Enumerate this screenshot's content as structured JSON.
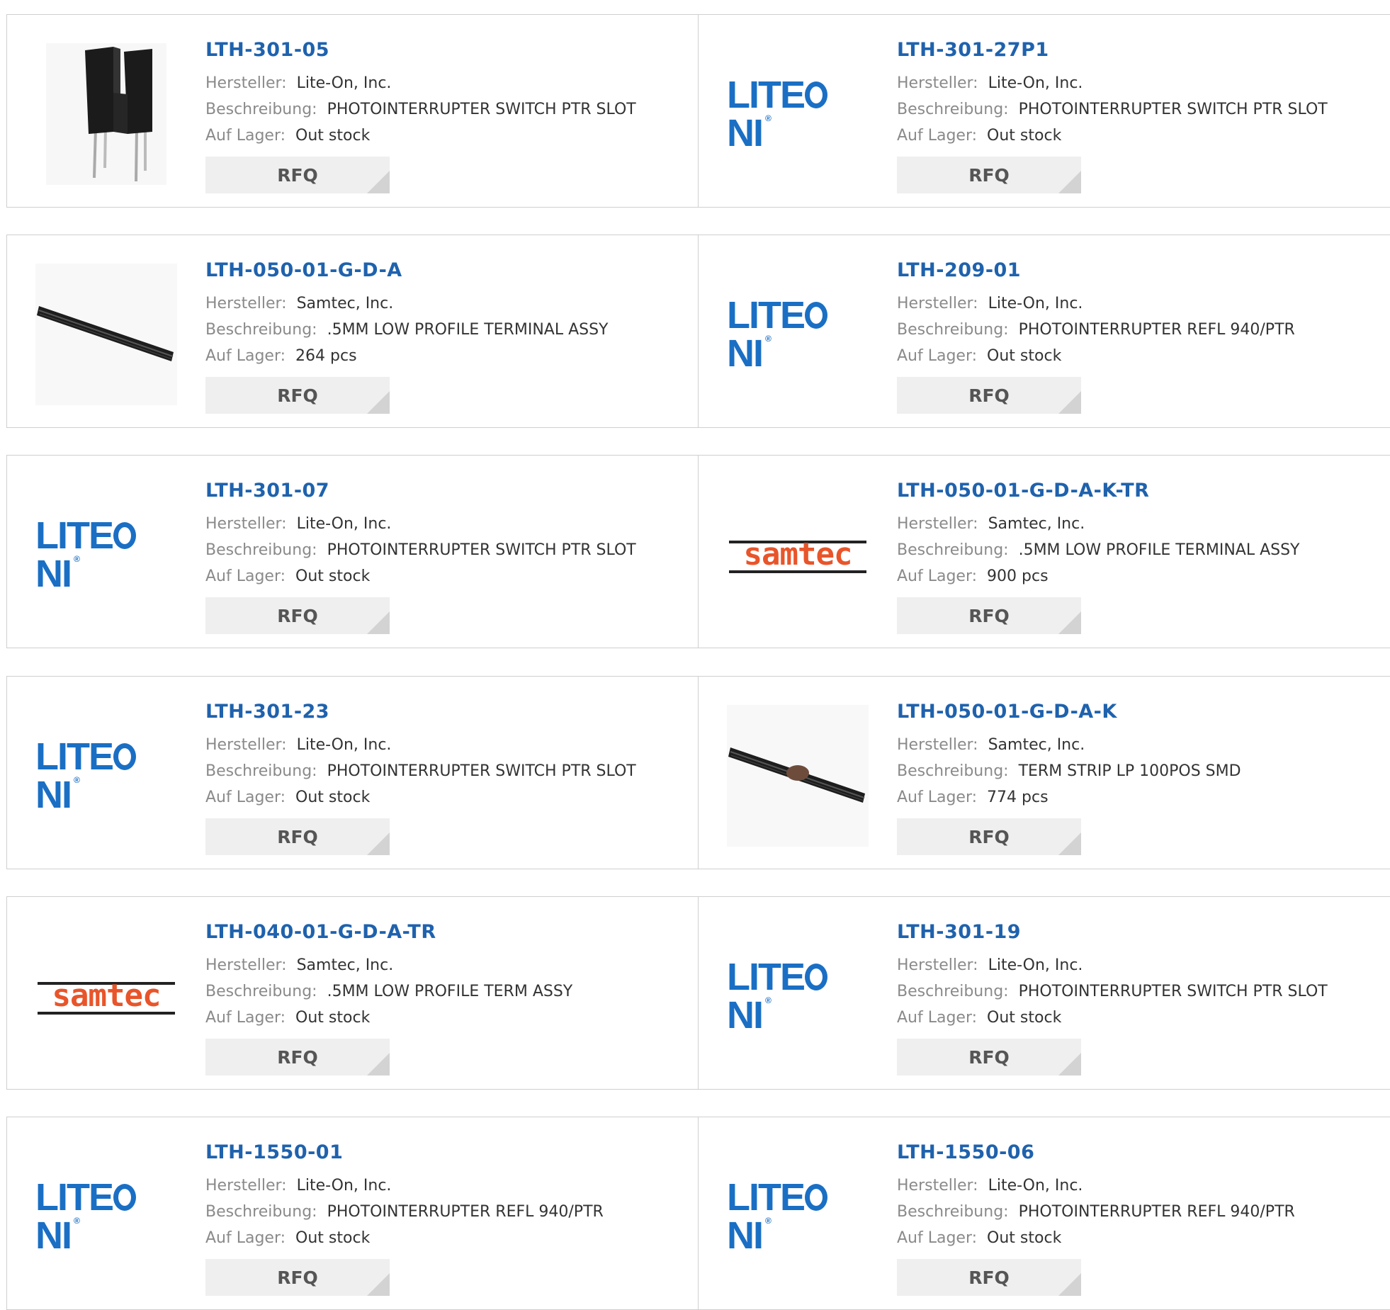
{
  "labels": {
    "manufacturer": "Hersteller:",
    "description": "Beschreibung:",
    "stock": "Auf Lager:",
    "rfq": "RFQ"
  },
  "logos": {
    "liteon": "LITEON",
    "samtec": "samtec"
  },
  "products": [
    {
      "pn": "LTH-301-05",
      "manufacturer": "Lite-On, Inc.",
      "description": "PHOTOINTERRUPTER SWITCH PTR SLOT",
      "stock": "Out stock",
      "image": "photointerrupter-photo"
    },
    {
      "pn": "LTH-301-27P1",
      "manufacturer": "Lite-On, Inc.",
      "description": "PHOTOINTERRUPTER SWITCH PTR SLOT",
      "stock": "Out stock",
      "image": "liteon-logo"
    },
    {
      "pn": "LTH-050-01-G-D-A",
      "manufacturer": "Samtec, Inc.",
      "description": ".5MM LOW PROFILE TERMINAL ASSY",
      "stock": "264 pcs",
      "image": "terminal-strip-photo"
    },
    {
      "pn": "LTH-209-01",
      "manufacturer": "Lite-On, Inc.",
      "description": "PHOTOINTERRUPTER REFL 940/PTR",
      "stock": "Out stock",
      "image": "liteon-logo"
    },
    {
      "pn": "LTH-301-07",
      "manufacturer": "Lite-On, Inc.",
      "description": "PHOTOINTERRUPTER SWITCH PTR SLOT",
      "stock": "Out stock",
      "image": "liteon-logo"
    },
    {
      "pn": "LTH-050-01-G-D-A-K-TR",
      "manufacturer": "Samtec, Inc.",
      "description": ".5MM LOW PROFILE TERMINAL ASSY",
      "stock": "900 pcs",
      "image": "samtec-logo"
    },
    {
      "pn": "LTH-301-23",
      "manufacturer": "Lite-On, Inc.",
      "description": "PHOTOINTERRUPTER SWITCH PTR SLOT",
      "stock": "Out stock",
      "image": "liteon-logo"
    },
    {
      "pn": "LTH-050-01-G-D-A-K",
      "manufacturer": "Samtec, Inc.",
      "description": "TERM STRIP LP 100POS SMD",
      "stock": "774 pcs",
      "image": "terminal-strip-photo-2"
    },
    {
      "pn": "LTH-040-01-G-D-A-TR",
      "manufacturer": "Samtec, Inc.",
      "description": ".5MM LOW PROFILE TERM ASSY",
      "stock": "Out stock",
      "image": "samtec-logo"
    },
    {
      "pn": "LTH-301-19",
      "manufacturer": "Lite-On, Inc.",
      "description": "PHOTOINTERRUPTER SWITCH PTR SLOT",
      "stock": "Out stock",
      "image": "liteon-logo"
    },
    {
      "pn": "LTH-1550-01",
      "manufacturer": "Lite-On, Inc.",
      "description": "PHOTOINTERRUPTER REFL 940/PTR",
      "stock": "Out stock",
      "image": "liteon-logo"
    },
    {
      "pn": "LTH-1550-06",
      "manufacturer": "Lite-On, Inc.",
      "description": "PHOTOINTERRUPTER REFL 940/PTR",
      "stock": "Out stock",
      "image": "liteon-logo"
    }
  ]
}
